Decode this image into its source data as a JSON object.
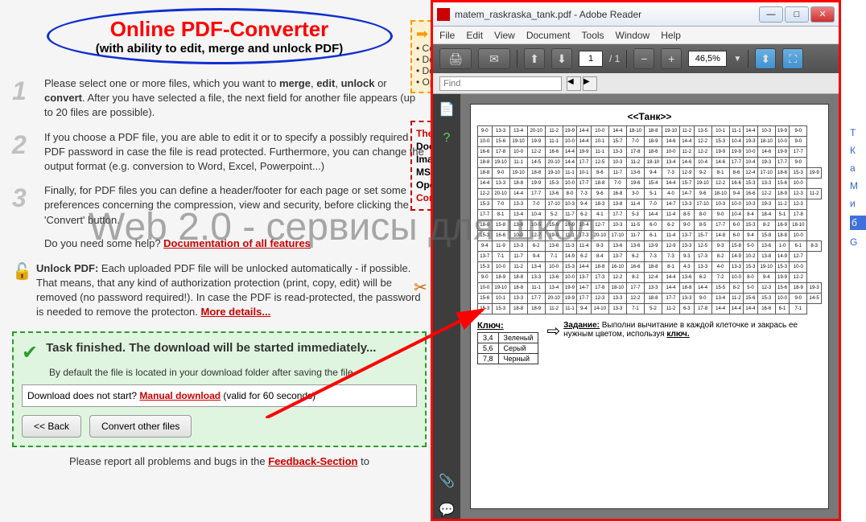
{
  "header": {
    "title": "Online PDF-Converter",
    "subtitle": "(with ability to edit, merge and unlock PDF)"
  },
  "steps": {
    "s1_a": "Please select one or more files, which you want to ",
    "s1_b": "merge",
    "s1_c": "edit",
    "s1_d": "unlock",
    "s1_e": " or ",
    "s1_f": "convert",
    "s1_g": ". After you have selected a file, the next field for another file appears (up to 20 files are possible).",
    "s2": "If you choose a PDF file, you are able to edit it or to specify a possibly required PDF password in case the file is read protected. Furthermore, you can change the output format (e.g. conversion to Word, Excel, Powerpoint...)",
    "s3": "Finally, for PDF files you can define a header/footer for each page or set some preferences concerning the compression, view and security, before clicking the 'Convert' button."
  },
  "help": {
    "q": "Do you need some help? ",
    "link": "Documentation of all features"
  },
  "unlock": {
    "title": "Unlock PDF:",
    "text": " Each uploaded PDF file will be unlocked automatically - if possible. That means, that any kind of authorization protection (print, copy, edit) will be removed (no password required!). In case the PDF is read-protected, the password is needed to remove the protecton. ",
    "more": "More details..."
  },
  "task": {
    "title": "Task finished. The download will be started immediately...",
    "sub": "By default the file is located in your download folder after saving the file.",
    "box_a": "Download does not start? ",
    "box_link": "Manual download",
    "box_b": " (valid for 60 seconds)",
    "back": "<< Back",
    "convert": "Convert other files"
  },
  "report": {
    "text": "Please report all problems and bugs in the ",
    "link": "Feedback-Section",
    "tail": " to"
  },
  "hints": {
    "c": "Co",
    "d1": "Do",
    "d2": "Do",
    "o": "Op"
  },
  "formats": {
    "the": "The",
    "doc": "Doc",
    "img": "Imag",
    "ms": "MS C",
    "ope": "Ope",
    "co": "Con"
  },
  "reader": {
    "title": "matem_raskraska_tank.pdf - Adobe Reader",
    "menu": [
      "File",
      "Edit",
      "View",
      "Document",
      "Tools",
      "Window",
      "Help"
    ],
    "page": "1",
    "pages": "/ 1",
    "zoom": "46,5%",
    "find": "Find",
    "doc_title": "<<Танк>>",
    "key_title": "Ключ:",
    "key_rows": [
      [
        "3,4",
        "Зеленый"
      ],
      [
        "5,6",
        "Серый"
      ],
      [
        "7,8",
        "Черный"
      ]
    ],
    "task_label": "Задание:",
    "task_text": " Выполни вычитание в каждой клеточке и закрась ее нужным цветом, используя ",
    "task_key": "ключ."
  },
  "grid": [
    [
      "9-0",
      "13-3",
      "13-4",
      "20-10",
      "11-2",
      "19-9",
      "14-4",
      "10-0",
      "14-4",
      "18-10",
      "18-8",
      "19-10",
      "11-2",
      "13-5",
      "10-1",
      "11-1",
      "14-4",
      "10-3",
      "19-9",
      "9-0"
    ],
    [
      "10-0",
      "15-6",
      "19-10",
      "19-9",
      "11-1",
      "10-0",
      "14-4",
      "10-1",
      "15-7",
      "7-0",
      "18-9",
      "14-6",
      "14-4",
      "12-2",
      "15-3",
      "10-4",
      "19-3",
      "18-10",
      "10-0",
      "9-0"
    ],
    [
      "16-6",
      "17-8",
      "10-0",
      "12-2",
      "16-6",
      "14-4",
      "19-9",
      "11-1",
      "13-3",
      "17-8",
      "18-6",
      "10-0",
      "11-2",
      "12-2",
      "19-9",
      "19-9",
      "10-0",
      "14-6",
      "19-9",
      "17-7"
    ],
    [
      "18-8",
      "19-10",
      "11-1",
      "14-5",
      "20-10",
      "14-4",
      "17-7",
      "12-5",
      "10-3",
      "11-2",
      "18-10",
      "13-4",
      "14-6",
      "10-4",
      "14-6",
      "17-7",
      "10-4",
      "19-3",
      "17-7",
      "9-0"
    ],
    [
      "18-8",
      "9-0",
      "19-10",
      "18-8",
      "19-10",
      "11-1",
      "10-1",
      "8-6",
      "11-7",
      "13-6",
      "9-4",
      "7-3",
      "12-9",
      "9-2",
      "8-1",
      "8-6",
      "12-4",
      "17-10",
      "18-6",
      "15-3",
      "19-9"
    ],
    [
      "14-4",
      "13-3",
      "18-8",
      "19-9",
      "15-3",
      "10-0",
      "17-7",
      "18-8",
      "7-0",
      "19-6",
      "15-4",
      "14-4",
      "15-7",
      "19-10",
      "12-2",
      "16-6",
      "15-3",
      "13-3",
      "15-6",
      "10-0"
    ],
    [
      "12-2",
      "20-10",
      "14-4",
      "17-7",
      "13-6",
      "8-0",
      "7-3",
      "9-6",
      "16-8",
      "3-0",
      "5-1",
      "4-0",
      "14-7",
      "9-6",
      "18-10",
      "9-4",
      "16-6",
      "12-2",
      "18-9",
      "12-3",
      "11-2"
    ],
    [
      "15-3",
      "7-0",
      "13-3",
      "7-0",
      "17-10",
      "10-3",
      "9-4",
      "18-3",
      "13-8",
      "11-4",
      "7-0",
      "14-7",
      "13-3",
      "17-10",
      "10-3",
      "10-0",
      "10-3",
      "19-3",
      "11-2",
      "12-3"
    ],
    [
      "17-7",
      "8-1",
      "13-4",
      "10-4",
      "5-2",
      "11-7",
      "6-2",
      "4-1",
      "17-7",
      "5-3",
      "14-4",
      "11-4",
      "8-5",
      "8-0",
      "9-0",
      "10-4",
      "8-4",
      "18-4",
      "5-1",
      "17-8"
    ],
    [
      "18-8",
      "15-8",
      "13-8",
      "10-5",
      "15-9",
      "16-9",
      "10-4",
      "12-7",
      "10-3",
      "11-5",
      "6-0",
      "6-2",
      "9-0",
      "8-5",
      "17-7",
      "6-0",
      "15-3",
      "8-2",
      "16-9",
      "18-10"
    ],
    [
      "15-3",
      "16-6",
      "10-0",
      "12-7",
      "19-9",
      "11-1",
      "17-3",
      "20-10",
      "17-10",
      "11-7",
      "6-1",
      "11-4",
      "13-7",
      "15-7",
      "14-8",
      "6-0",
      "9-4",
      "15-8",
      "18-8",
      "10-0"
    ],
    [
      "9-4",
      "11-9",
      "13-3",
      "6-2",
      "13-6",
      "11-3",
      "11-4",
      "8-3",
      "13-6",
      "13-6",
      "13-9",
      "12-9",
      "13-3",
      "12-5",
      "9-3",
      "15-8",
      "5-0",
      "13-6",
      "1-0",
      "6-1",
      "8-3"
    ],
    [
      "13-7",
      "7-1",
      "11-7",
      "9-4",
      "7-1",
      "14-9",
      "6-2",
      "8-4",
      "13-7",
      "6-2",
      "7-3",
      "7-3",
      "9-3",
      "17-3",
      "8-2",
      "14-9",
      "10-2",
      "13-8",
      "14-9",
      "12-7"
    ],
    [
      "15-3",
      "10-0",
      "11-2",
      "13-4",
      "10-0",
      "15-3",
      "14-4",
      "18-8",
      "16-10",
      "16-6",
      "18-8",
      "8-1",
      "4-3",
      "13-3",
      "4-0",
      "13-3",
      "15-3",
      "19-10",
      "15-3",
      "10-0"
    ],
    [
      "9-0",
      "18-9",
      "18-8",
      "13-3",
      "13-6",
      "10-0",
      "13-7",
      "17-3",
      "12-2",
      "8-2",
      "12-4",
      "14-4",
      "13-6",
      "6-2",
      "7-2",
      "10-0",
      "8-0",
      "9-4",
      "19-9",
      "12-2"
    ],
    [
      "10-0",
      "19-10",
      "18-8",
      "11-1",
      "13-4",
      "19-9",
      "14-7",
      "17-8",
      "18-10",
      "17-7",
      "13-3",
      "14-4",
      "18-8",
      "14-4",
      "15-5",
      "8-2",
      "5-0",
      "12-3",
      "15-6",
      "18-9",
      "19-3"
    ],
    [
      "15-6",
      "10-1",
      "13-3",
      "17-7",
      "20-10",
      "19-9",
      "17-7",
      "12-3",
      "13-3",
      "12-2",
      "18-8",
      "17-7",
      "13-3",
      "9-0",
      "13-4",
      "11-2",
      "15-6",
      "15-3",
      "10-0",
      "9-0",
      "14-5"
    ],
    [
      "15-3",
      "15-3",
      "18-8",
      "18-9",
      "11-2",
      "11-1",
      "9-4",
      "14-10",
      "13-3",
      "7-1",
      "5-2",
      "11-2",
      "6-3",
      "17-8",
      "14-4",
      "14-4",
      "14-4",
      "16-6",
      "6-1",
      "7-1"
    ]
  ],
  "overlay": "Web 2.0 - сервисы для школ",
  "right_snip": [
    "Т",
    "К",
    "а",
    "М",
    "и",
    "б",
    "G"
  ]
}
